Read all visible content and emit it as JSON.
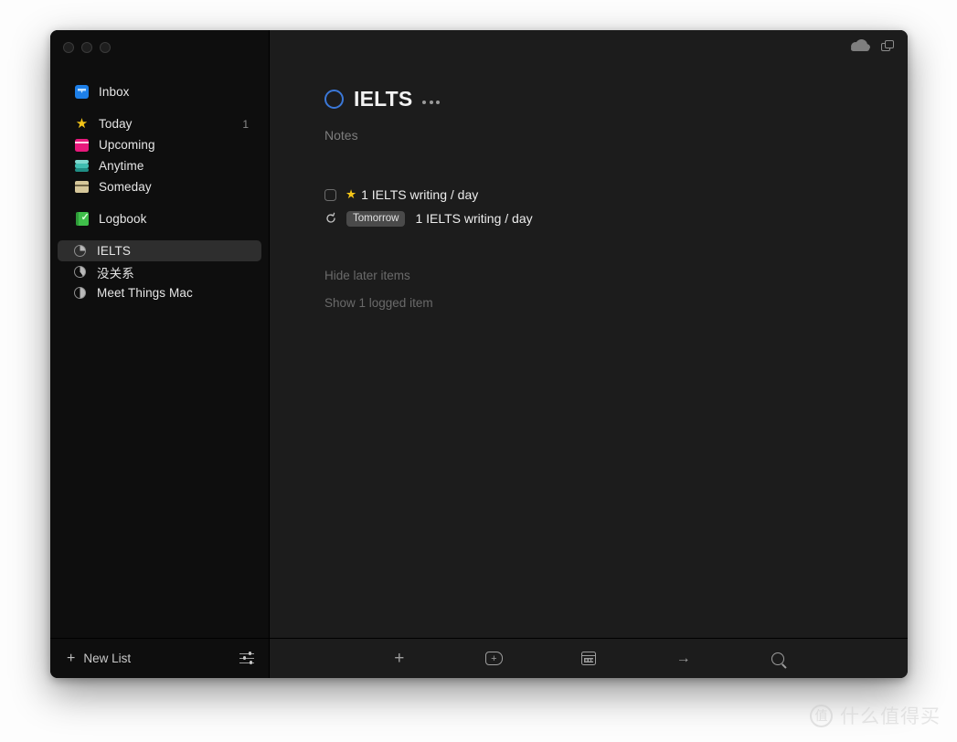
{
  "window": {
    "traffic_lights": [
      "close",
      "minimize",
      "zoom"
    ],
    "sync_icon": "cloud-icon",
    "quick_entry_icon": "window-stack-icon"
  },
  "sidebar": {
    "primary": [
      {
        "label": "Inbox",
        "icon": "inbox-icon",
        "count": ""
      },
      {
        "label": "Today",
        "icon": "star-icon",
        "count": "1"
      },
      {
        "label": "Upcoming",
        "icon": "calendar-icon",
        "count": ""
      },
      {
        "label": "Anytime",
        "icon": "layers-icon",
        "count": ""
      },
      {
        "label": "Someday",
        "icon": "box-icon",
        "count": ""
      },
      {
        "label": "Logbook",
        "icon": "logbook-icon",
        "count": ""
      }
    ],
    "projects": [
      {
        "label": "IELTS",
        "icon": "pie-progress-icon",
        "progress": 25,
        "selected": true
      },
      {
        "label": "没关系",
        "icon": "pie-progress-icon",
        "progress": 40,
        "selected": false
      },
      {
        "label": "Meet Things Mac",
        "icon": "pie-progress-icon",
        "progress": 50,
        "selected": false
      }
    ],
    "footer": {
      "new_list_label": "New List",
      "new_list_icon": "plus-icon",
      "settings_icon": "sliders-icon"
    }
  },
  "main": {
    "title": "IELTS",
    "title_icon": "pie-progress-icon",
    "title_progress": 25,
    "more_icon": "ellipsis-icon",
    "notes_placeholder": "Notes",
    "tasks": [
      {
        "checkbox": "unchecked",
        "star_icon": "star-icon",
        "badge": "",
        "text": "1 IELTS writing / day"
      },
      {
        "repeat_icon": "repeat-icon",
        "badge": "Tomorrow",
        "text": "1 IELTS writing / day"
      }
    ],
    "links": [
      "Hide later items",
      "Show 1 logged item"
    ],
    "toolbar": [
      {
        "icon": "plus-icon",
        "name": "new-to-do"
      },
      {
        "icon": "new-project-icon",
        "name": "new-project"
      },
      {
        "icon": "calendar-icon",
        "name": "when"
      },
      {
        "icon": "arrow-right-icon",
        "name": "move"
      },
      {
        "icon": "search-icon",
        "name": "search"
      }
    ]
  },
  "watermark": {
    "logo": "值",
    "text": "什么值得买"
  },
  "colors": {
    "sidebar_bg": "#0e0e0e",
    "main_bg": "#1c1c1c",
    "selected_row": "#2e2e2e",
    "accent_blue": "#3b78d8",
    "star_gold": "#f4c518",
    "badge_bg": "#4a4a4a"
  }
}
